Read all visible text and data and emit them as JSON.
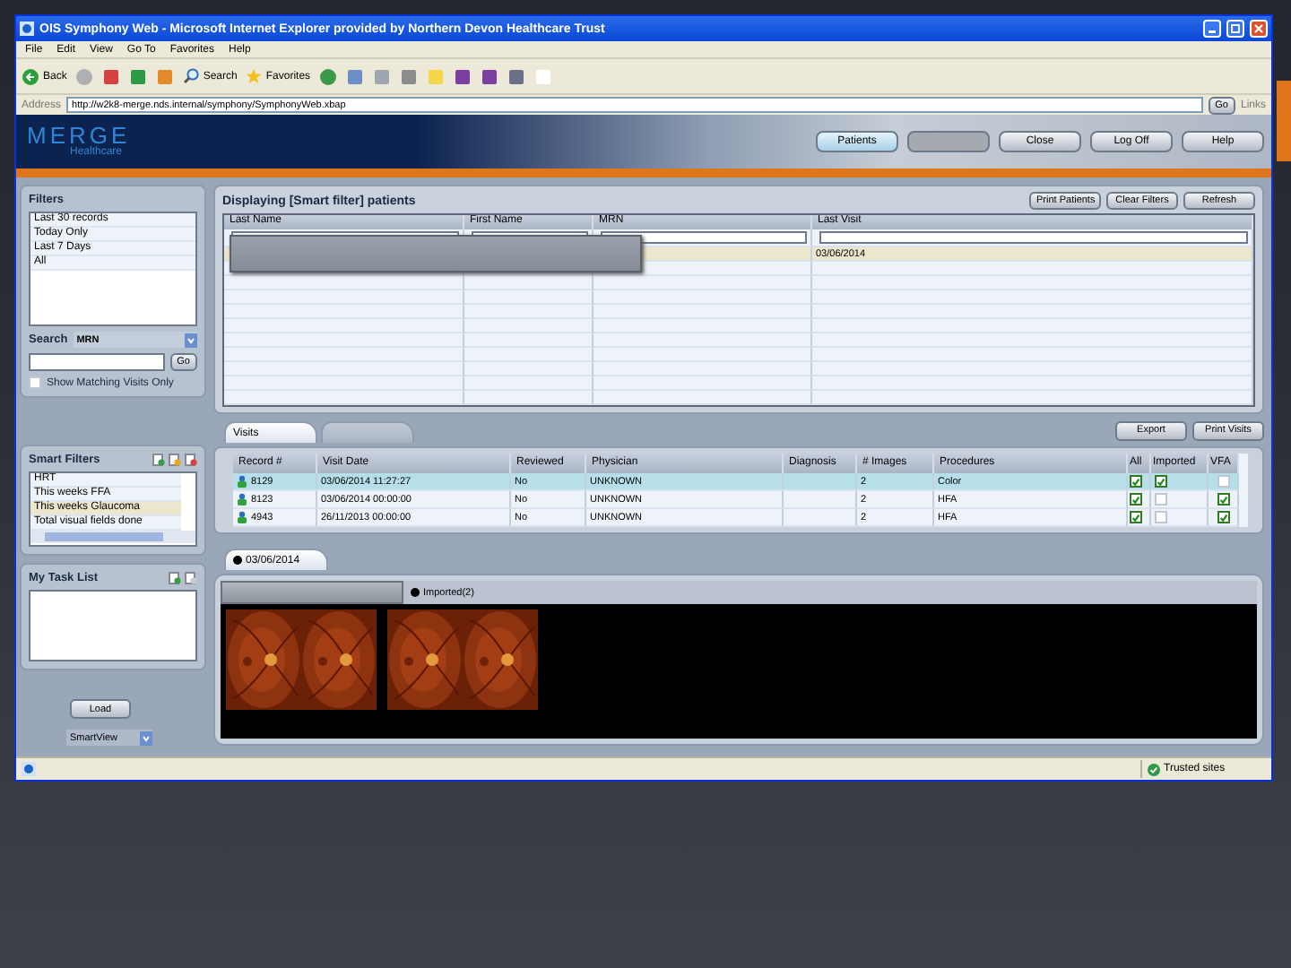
{
  "window": {
    "title": "OIS Symphony Web - Microsoft Internet Explorer provided by Northern Devon Healthcare Trust"
  },
  "menu": [
    "File",
    "Edit",
    "View",
    "Go To",
    "Favorites",
    "Help"
  ],
  "toolbar": {
    "back": "Back",
    "search": "Search",
    "favorites": "Favorites"
  },
  "address": {
    "label": "Address",
    "url": "http://w2k8-merge.nds.internal/symphony/SymphonyWeb.xbap",
    "go": "Go",
    "links": "Links"
  },
  "logo": {
    "brand": "MERGE",
    "sub": "Healthcare"
  },
  "header_buttons": [
    {
      "label": "Patients",
      "selected": true,
      "disabled": false
    },
    {
      "selected": false,
      "disabled": true
    },
    {
      "label": "Close",
      "selected": false,
      "disabled": false
    },
    {
      "label": "Log Off",
      "selected": false,
      "disabled": false
    },
    {
      "label": "Help",
      "selected": false,
      "disabled": false
    }
  ],
  "sidebar": {
    "filters_title": "Filters",
    "filters": [
      "Last 30 records",
      "Today Only",
      "Last 7 Days",
      "All"
    ],
    "search_label": "Search",
    "search_by": "MRN",
    "go": "Go",
    "show_matching": {
      "label": "Show Matching Visits Only",
      "checked": false
    },
    "smart_filters_title": "Smart Filters",
    "smart_filters": [
      {
        "label": "HRT",
        "selected": false
      },
      {
        "label": "This weeks FFA",
        "selected": false
      },
      {
        "label": "This weeks Glaucoma",
        "selected": true
      },
      {
        "label": "Total visual fields done",
        "selected": false
      }
    ],
    "task_list_title": "My Task List",
    "load": "Load",
    "view": "SmartView"
  },
  "patients": {
    "title": "Displaying [Smart filter] patients",
    "buttons": [
      "Print Patients",
      "Clear Filters",
      "Refresh"
    ],
    "columns": [
      "Last Name",
      "First Name",
      "MRN",
      "Last Visit"
    ],
    "rows": [
      {
        "last_visit": "03/06/2014",
        "selected": true
      }
    ]
  },
  "visit_tabs": [
    {
      "label": "Visits",
      "selected": true
    },
    {
      "selected": false
    }
  ],
  "visit_buttons": [
    "Export",
    "Print Visits"
  ],
  "visits": {
    "columns": [
      "Record #",
      "Visit Date",
      "Reviewed",
      "Physician",
      "Diagnosis",
      "# Images",
      "Procedures",
      "All",
      "Imported",
      "VFA"
    ],
    "rows": [
      {
        "record": "8129",
        "date": "03/06/2014 11:27:27",
        "reviewed": "No",
        "physician": "UNKNOWN",
        "images": "2",
        "procedures": "Color",
        "all": true,
        "imported": true,
        "vfa": false,
        "selected": true
      },
      {
        "record": "8123",
        "date": "03/06/2014 00:00:00",
        "reviewed": "No",
        "physician": "UNKNOWN",
        "images": "2",
        "procedures": "HFA",
        "all": true,
        "imported": false,
        "vfa": true,
        "selected": false
      },
      {
        "record": "4943",
        "date": "26/11/2013 00:00:00",
        "reviewed": "No",
        "physician": "UNKNOWN",
        "images": "2",
        "procedures": "HFA",
        "all": true,
        "imported": false,
        "vfa": true,
        "selected": false
      }
    ]
  },
  "date_tab": "03/06/2014",
  "image_tabs": [
    {
      "selected": true
    },
    {
      "label": "Imported(2)",
      "selected": false
    }
  ],
  "images": [
    {
      "kind": "picture"
    },
    {
      "kind": "picture"
    },
    {
      "kind": "picture"
    },
    {
      "kind": "picture"
    }
  ],
  "status_bar": {
    "zone": "Trusted sites"
  }
}
